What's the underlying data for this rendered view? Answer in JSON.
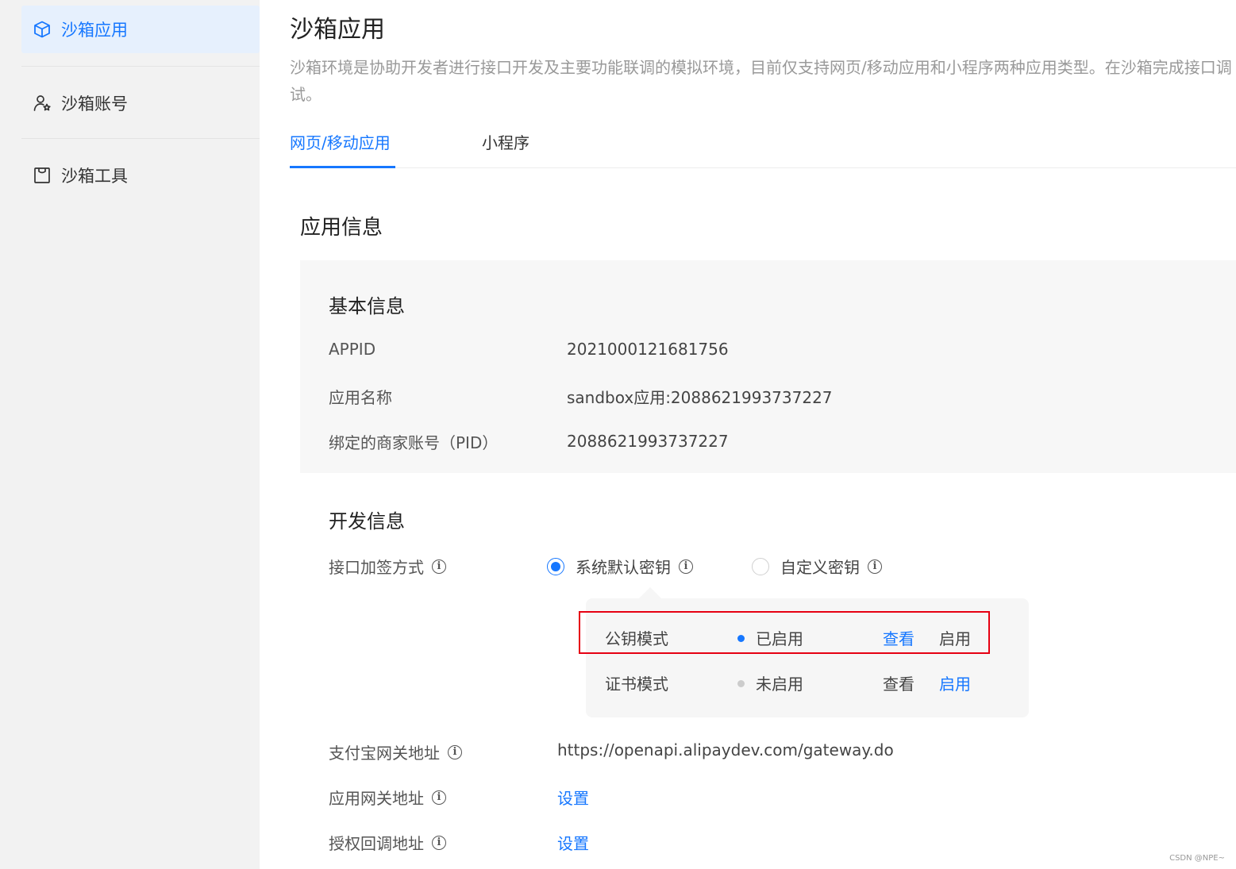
{
  "sidebar": {
    "items": [
      {
        "label": "沙箱应用",
        "icon": "cube-icon",
        "active": true
      },
      {
        "label": "沙箱账号",
        "icon": "user-star-icon",
        "active": false
      },
      {
        "label": "沙箱工具",
        "icon": "bag-icon",
        "active": false
      }
    ]
  },
  "header": {
    "title": "沙箱应用",
    "description": "沙箱环境是协助开发者进行接口开发及主要功能联调的模拟环境，目前仅支持网页/移动应用和小程序两种应用类型。在沙箱完成接口调试。"
  },
  "tabs": [
    {
      "label": "网页/移动应用",
      "active": true
    },
    {
      "label": "小程序",
      "active": false
    }
  ],
  "app_info": {
    "title": "应用信息",
    "basic": {
      "title": "基本信息",
      "rows": [
        {
          "label": "APPID",
          "value": "2021000121681756"
        },
        {
          "label": "应用名称",
          "value": "sandbox应用:2088621993737227"
        },
        {
          "label": "绑定的商家账号（PID）",
          "value": "2088621993737227"
        }
      ]
    },
    "dev": {
      "title": "开发信息",
      "sign_method": {
        "label": "接口加签方式",
        "options": [
          {
            "label": "系统默认密钥",
            "checked": true
          },
          {
            "label": "自定义密钥",
            "checked": false
          }
        ]
      },
      "modes": [
        {
          "name": "公钥模式",
          "status": "已启用",
          "status_color": "#1677ff",
          "view": "查看",
          "enable": "启用",
          "view_link": true,
          "enable_link": false
        },
        {
          "name": "证书模式",
          "status": "未启用",
          "status_color": "#cccccc",
          "view": "查看",
          "enable": "启用",
          "view_link": false,
          "enable_link": true
        }
      ],
      "gateway": {
        "label": "支付宝网关地址",
        "value": "https://openapi.alipaydev.com/gateway.do"
      },
      "app_gateway": {
        "label": "应用网关地址",
        "action": "设置"
      },
      "auth_callback": {
        "label": "授权回调地址",
        "action": "设置"
      }
    }
  },
  "watermark": "CSDN @NPE~",
  "colors": {
    "accent": "#1677ff",
    "highlight": "#e60012"
  }
}
